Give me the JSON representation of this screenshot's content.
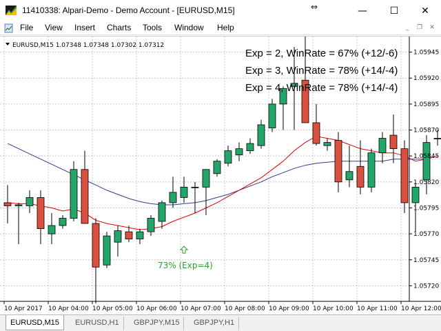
{
  "window": {
    "title": "11410338: Alpari-Demo - Demo Account - [EURUSD,M15]",
    "minimize_glyph": "—",
    "maximize_glyph": "☐",
    "close_glyph": "✕",
    "resize_glyph": "⇔"
  },
  "menu": {
    "items": [
      "File",
      "View",
      "Insert",
      "Charts",
      "Tools",
      "Window",
      "Help"
    ]
  },
  "mdi": {
    "min": "_",
    "restore": "❐",
    "close": "✕"
  },
  "chart_data": {
    "type": "candlestick",
    "symbol_line": "EURUSD,M15  1.07348 1.07348 1.07302 1.07312",
    "ylim": [
      1.05705,
      1.0596
    ],
    "y_ticks": [
      "1.05945",
      "1.05920",
      "1.05895",
      "1.05870",
      "1.05845",
      "1.05820",
      "1.05795",
      "1.05770",
      "1.05745",
      "1.05720"
    ],
    "x_ticks": [
      "10 Apr 2017",
      "10 Apr 04:00",
      "10 Apr 05:00",
      "10 Apr 06:00",
      "10 Apr 07:00",
      "10 Apr 08:00",
      "10 Apr 09:00",
      "10 Apr 10:00",
      "10 Apr 11:00",
      "10 Apr 12:00"
    ],
    "colors": {
      "bull": "#26a56a",
      "bear": "#d9503f",
      "ma_fast": "#e00000",
      "ma_slow": "#2b3f8f",
      "grid": "#c8c8c8",
      "signal": "#2ca02c"
    },
    "candles": [
      {
        "o": 1.058,
        "h": 1.05817,
        "l": 1.0578,
        "c": 1.05797
      },
      {
        "o": 1.05797,
        "h": 1.058,
        "l": 1.0576,
        "c": 1.05798
      },
      {
        "o": 1.05797,
        "h": 1.05812,
        "l": 1.0579,
        "c": 1.05805
      },
      {
        "o": 1.05805,
        "h": 1.05812,
        "l": 1.0576,
        "c": 1.05775
      },
      {
        "o": 1.0577,
        "h": 1.0579,
        "l": 1.0576,
        "c": 1.05778
      },
      {
        "o": 1.05778,
        "h": 1.05788,
        "l": 1.05775,
        "c": 1.05785
      },
      {
        "o": 1.05785,
        "h": 1.0584,
        "l": 1.05782,
        "c": 1.05832
      },
      {
        "o": 1.05832,
        "h": 1.0585,
        "l": 1.0578,
        "c": 1.0578
      },
      {
        "o": 1.0578,
        "h": 1.05785,
        "l": 1.05703,
        "c": 1.05738
      },
      {
        "o": 1.0574,
        "h": 1.05772,
        "l": 1.05737,
        "c": 1.05768
      },
      {
        "o": 1.05762,
        "h": 1.05778,
        "l": 1.05748,
        "c": 1.05773
      },
      {
        "o": 1.05772,
        "h": 1.05778,
        "l": 1.05762,
        "c": 1.05765
      },
      {
        "o": 1.05765,
        "h": 1.05775,
        "l": 1.0576,
        "c": 1.05772
      },
      {
        "o": 1.05772,
        "h": 1.05788,
        "l": 1.05768,
        "c": 1.05785
      },
      {
        "o": 1.05782,
        "h": 1.05802,
        "l": 1.05775,
        "c": 1.058
      },
      {
        "o": 1.058,
        "h": 1.05825,
        "l": 1.05795,
        "c": 1.0581
      },
      {
        "o": 1.05805,
        "h": 1.05825,
        "l": 1.058,
        "c": 1.05815
      },
      {
        "o": 1.05815,
        "h": 1.0582,
        "l": 1.0579,
        "c": 1.05815
      },
      {
        "o": 1.05815,
        "h": 1.0583,
        "l": 1.05788,
        "c": 1.05832
      },
      {
        "o": 1.05828,
        "h": 1.05842,
        "l": 1.05825,
        "c": 1.0584
      },
      {
        "o": 1.05838,
        "h": 1.05855,
        "l": 1.05835,
        "c": 1.0585
      },
      {
        "o": 1.05846,
        "h": 1.05858,
        "l": 1.0584,
        "c": 1.05852
      },
      {
        "o": 1.0585,
        "h": 1.05862,
        "l": 1.05847,
        "c": 1.05857
      },
      {
        "o": 1.05855,
        "h": 1.0588,
        "l": 1.05852,
        "c": 1.05875
      },
      {
        "o": 1.05872,
        "h": 1.059,
        "l": 1.05868,
        "c": 1.05895
      },
      {
        "o": 1.05895,
        "h": 1.05912,
        "l": 1.0587,
        "c": 1.0591
      },
      {
        "o": 1.05912,
        "h": 1.0595,
        "l": 1.0587,
        "c": 1.05915
      },
      {
        "o": 1.05918,
        "h": 1.0596,
        "l": 1.0589,
        "c": 1.05877
      },
      {
        "o": 1.05877,
        "h": 1.05895,
        "l": 1.05855,
        "c": 1.05857
      },
      {
        "o": 1.05855,
        "h": 1.05862,
        "l": 1.0585,
        "c": 1.05858
      },
      {
        "o": 1.0586,
        "h": 1.05868,
        "l": 1.0581,
        "c": 1.0582
      },
      {
        "o": 1.05822,
        "h": 1.05855,
        "l": 1.05815,
        "c": 1.0583
      },
      {
        "o": 1.05835,
        "h": 1.0586,
        "l": 1.05808,
        "c": 1.05815
      },
      {
        "o": 1.05815,
        "h": 1.05852,
        "l": 1.0581,
        "c": 1.05848
      },
      {
        "o": 1.05848,
        "h": 1.05868,
        "l": 1.05838,
        "c": 1.05862
      },
      {
        "o": 1.05865,
        "h": 1.05885,
        "l": 1.05838,
        "c": 1.05852
      },
      {
        "o": 1.05852,
        "h": 1.0586,
        "l": 1.0579,
        "c": 1.058
      },
      {
        "o": 1.058,
        "h": 1.0582,
        "l": 1.05772,
        "c": 1.05815
      },
      {
        "o": 1.05822,
        "h": 1.05865,
        "l": 1.05808,
        "c": 1.05858
      },
      {
        "o": 1.05862,
        "h": 1.0587,
        "l": 1.05855,
        "c": 1.05862
      }
    ],
    "ma_fast": [
      1.058,
      1.05799,
      1.05799,
      1.05797,
      1.05795,
      1.05792,
      1.05794,
      1.0579,
      1.05783,
      1.0578,
      1.05778,
      1.05776,
      1.05774,
      1.05775,
      1.05777,
      1.05782,
      1.05786,
      1.0579,
      1.05795,
      1.058,
      1.05806,
      1.05812,
      1.05818,
      1.05824,
      1.05832,
      1.0584,
      1.0585,
      1.05858,
      1.05864,
      1.05862,
      1.0586,
      1.05856,
      1.05852,
      1.0585,
      1.05848,
      1.05848,
      1.05845,
      1.0584,
      1.05842,
      1.05845
    ],
    "ma_slow": [
      1.05857,
      1.05852,
      1.05847,
      1.05842,
      1.05837,
      1.05832,
      1.05827,
      1.05822,
      1.05817,
      1.05812,
      1.05808,
      1.05804,
      1.05801,
      1.05799,
      1.05798,
      1.05798,
      1.05799,
      1.058,
      1.05802,
      1.05805,
      1.05808,
      1.05812,
      1.05816,
      1.0582,
      1.05825,
      1.05829,
      1.05833,
      1.05836,
      1.05838,
      1.05839,
      1.0584,
      1.0584,
      1.0584,
      1.0584,
      1.0584,
      1.05842,
      1.05842,
      1.05842,
      1.05842,
      1.05845
    ],
    "overlay": [
      "Exp = 2, WinRate = 67% (+12/-6)",
      "Exp = 3, WinRate = 78% (+14/-4)",
      "Exp = 4, WinRate = 78% (+14/-4)"
    ],
    "signal_label": "73% (Exp=4)",
    "signal_index": 16,
    "signal_price": 1.0577
  },
  "tabs": [
    "EURUSD,M15",
    "EURUSD,H1",
    "GBPJPY,M15",
    "GBPJPY,H1"
  ]
}
